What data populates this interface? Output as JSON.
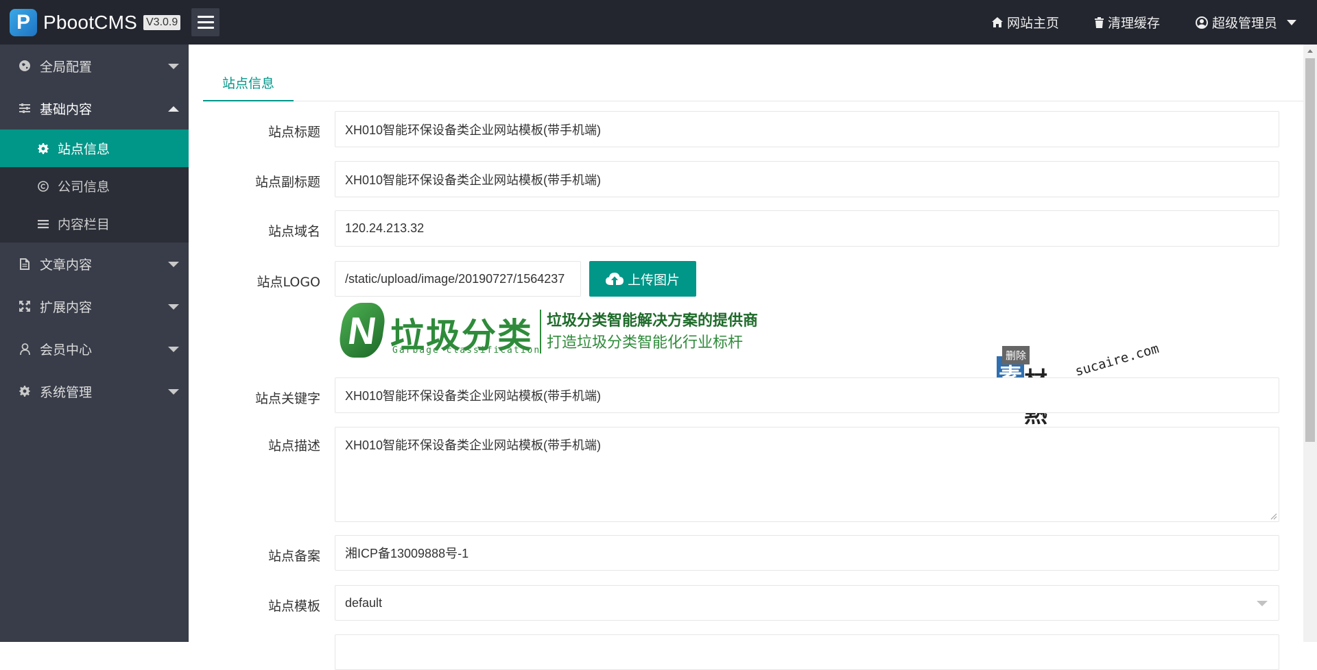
{
  "header": {
    "logo_mark": "P",
    "app_name": "PbootCMS",
    "version": "V3.0.9",
    "links": [
      {
        "label": "网站主页",
        "icon": "home-icon"
      },
      {
        "label": "清理缓存",
        "icon": "trash-icon"
      },
      {
        "label": "超级管理员",
        "icon": "user-circle-icon"
      }
    ]
  },
  "sidebar": {
    "items": [
      {
        "label": "全局配置",
        "icon": "globe-icon"
      },
      {
        "label": "基础内容",
        "icon": "sliders-icon"
      },
      {
        "label": "文章内容",
        "icon": "document-icon"
      },
      {
        "label": "扩展内容",
        "icon": "expand-icon"
      },
      {
        "label": "会员中心",
        "icon": "user-icon"
      },
      {
        "label": "系统管理",
        "icon": "gear-icon"
      }
    ],
    "subitems": [
      {
        "label": "站点信息",
        "icon": "gear-icon"
      },
      {
        "label": "公司信息",
        "icon": "copyright-icon"
      },
      {
        "label": "内容栏目",
        "icon": "list-icon"
      }
    ]
  },
  "main": {
    "tab": "站点信息",
    "fields": {
      "title": {
        "label": "站点标题",
        "value": "XH010智能环保设备类企业网站模板(带手机端)"
      },
      "subtitle": {
        "label": "站点副标题",
        "value": "XH010智能环保设备类企业网站模板(带手机端)"
      },
      "domain": {
        "label": "站点域名",
        "value": "120.24.213.32"
      },
      "logo": {
        "label": "站点LOGO",
        "value": "/static/upload/image/20190727/1564237"
      },
      "keywords": {
        "label": "站点关键字",
        "value": "XH010智能环保设备类企业网站模板(带手机端)"
      },
      "description": {
        "label": "站点描述",
        "value": "XH010智能环保设备类企业网站模板(带手机端)"
      },
      "icp": {
        "label": "站点备案",
        "value": "湘ICP备13009888号-1"
      },
      "template": {
        "label": "站点模板",
        "value": "default"
      }
    },
    "upload_label": "上传图片",
    "preview": {
      "n": "N",
      "cn": "垃圾分类",
      "en": "Garbage classification",
      "slogan1": "垃圾分类智能解决方案的提供商",
      "slogan2": "打造垃圾分类智能化行业标杆"
    },
    "delete_label": "删除",
    "watermark": {
      "su": "素",
      "rest": "材熱",
      "url": "sucaire.com"
    }
  }
}
